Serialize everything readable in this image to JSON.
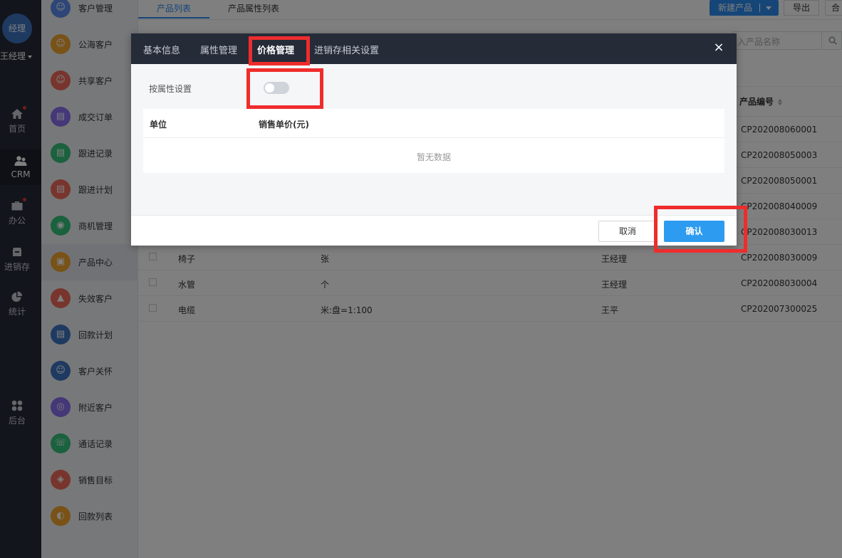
{
  "rail": {
    "avatar": "经理",
    "user": "王经理",
    "items": [
      {
        "label": "首页",
        "icon": "home-icon",
        "dot": true
      },
      {
        "label": "CRM",
        "icon": "people-icon",
        "dot": false,
        "active": true
      },
      {
        "label": "办公",
        "icon": "briefcase-icon",
        "dot": true
      },
      {
        "label": "进销存",
        "icon": "box-icon",
        "dot": false
      },
      {
        "label": "统计",
        "icon": "pie-chart-icon",
        "dot": false
      },
      {
        "label": "后台",
        "icon": "grid-icon",
        "dot": false
      }
    ]
  },
  "menu": {
    "items": [
      {
        "label": "客户管理",
        "color": "#5b8def",
        "glyph": "☺"
      },
      {
        "label": "公海客户",
        "color": "#f0a52e",
        "glyph": "☺"
      },
      {
        "label": "共享客户",
        "color": "#ef6b5b",
        "glyph": "☺"
      },
      {
        "label": "成交订单",
        "color": "#8a6ff0",
        "glyph": "▤"
      },
      {
        "label": "跟进记录",
        "color": "#34c27c",
        "glyph": "▤"
      },
      {
        "label": "跟进计划",
        "color": "#ef6b5b",
        "glyph": "▤"
      },
      {
        "label": "商机管理",
        "color": "#34c27c",
        "glyph": "◉"
      },
      {
        "label": "产品中心",
        "color": "#f0a52e",
        "glyph": "▣",
        "active": true
      },
      {
        "label": "失效客户",
        "color": "#ef6b5b",
        "glyph": "▲"
      },
      {
        "label": "回款计划",
        "color": "#3f74c3",
        "glyph": "▤"
      },
      {
        "label": "客户关怀",
        "color": "#3f74c3",
        "glyph": "☺"
      },
      {
        "label": "附近客户",
        "color": "#8a6ff0",
        "glyph": "◎"
      },
      {
        "label": "通话记录",
        "color": "#34c27c",
        "glyph": "☏"
      },
      {
        "label": "销售目标",
        "color": "#ef6b5b",
        "glyph": "◈"
      },
      {
        "label": "回款列表",
        "color": "#f0a52e",
        "glyph": "◐"
      }
    ]
  },
  "topbar": {
    "tabs": [
      "产品列表",
      "产品属性列表"
    ],
    "new_button": "新建产品",
    "export_button": "导出",
    "more_button": "合"
  },
  "list": {
    "search_placeholder": "入产品名称",
    "code_header": "产品编号",
    "codes_top": [
      "CP202008060001",
      "CP202008050003",
      "CP202008050001",
      "CP202008040009",
      "CP202008030013"
    ],
    "rows": [
      {
        "name": "椅子",
        "unit": "张",
        "owner": "王经理",
        "code": "CP202008030009"
      },
      {
        "name": "水管",
        "unit": "个",
        "owner": "王经理",
        "code": "CP202008030004"
      },
      {
        "name": "电缆",
        "unit": "米:盘=1:100",
        "owner": "王平",
        "code": "CP202007300025"
      }
    ]
  },
  "modal": {
    "tabs": [
      "基本信息",
      "属性管理",
      "价格管理",
      "进销存相关设置"
    ],
    "active_tab": 2,
    "close": "×",
    "attr_setting_label": "按属性设置",
    "attr_setting_on": false,
    "table_headers": [
      "单位",
      "销售单价(元)"
    ],
    "empty_text": "暂无数据",
    "cancel_button": "取消",
    "confirm_button": "确认"
  },
  "highlight_color": "#ef2c2c"
}
